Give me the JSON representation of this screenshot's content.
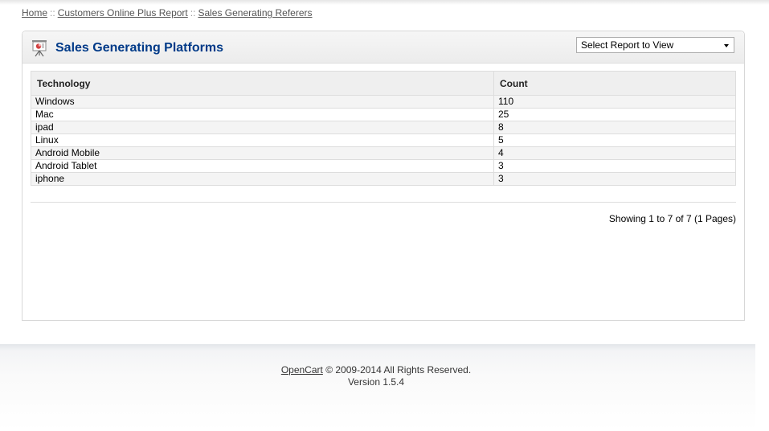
{
  "breadcrumb": {
    "home": "Home",
    "report": "Customers Online Plus Report",
    "current": "Sales Generating Referers",
    "separator": "::"
  },
  "panel": {
    "title": "Sales Generating Platforms",
    "icon": "presentation-board-icon",
    "report_select": "Select Report to View"
  },
  "table": {
    "headers": [
      "Technology",
      "Count"
    ],
    "rows": [
      [
        "Windows",
        "110"
      ],
      [
        "Mac",
        "25"
      ],
      [
        "ipad",
        "8"
      ],
      [
        "Linux",
        "5"
      ],
      [
        "Android Mobile",
        "4"
      ],
      [
        "Android Tablet",
        "3"
      ],
      [
        "iphone",
        "3"
      ]
    ]
  },
  "pagination": "Showing 1 to 7 of 7 (1 Pages)",
  "footer": {
    "link": "OpenCart",
    "copyright": "© 2009-2014 All Rights Reserved.",
    "version": "Version 1.5.4"
  },
  "colors": {
    "title": "#003a88",
    "border": "#dddddd",
    "row_alt": "#f4f4f4"
  }
}
